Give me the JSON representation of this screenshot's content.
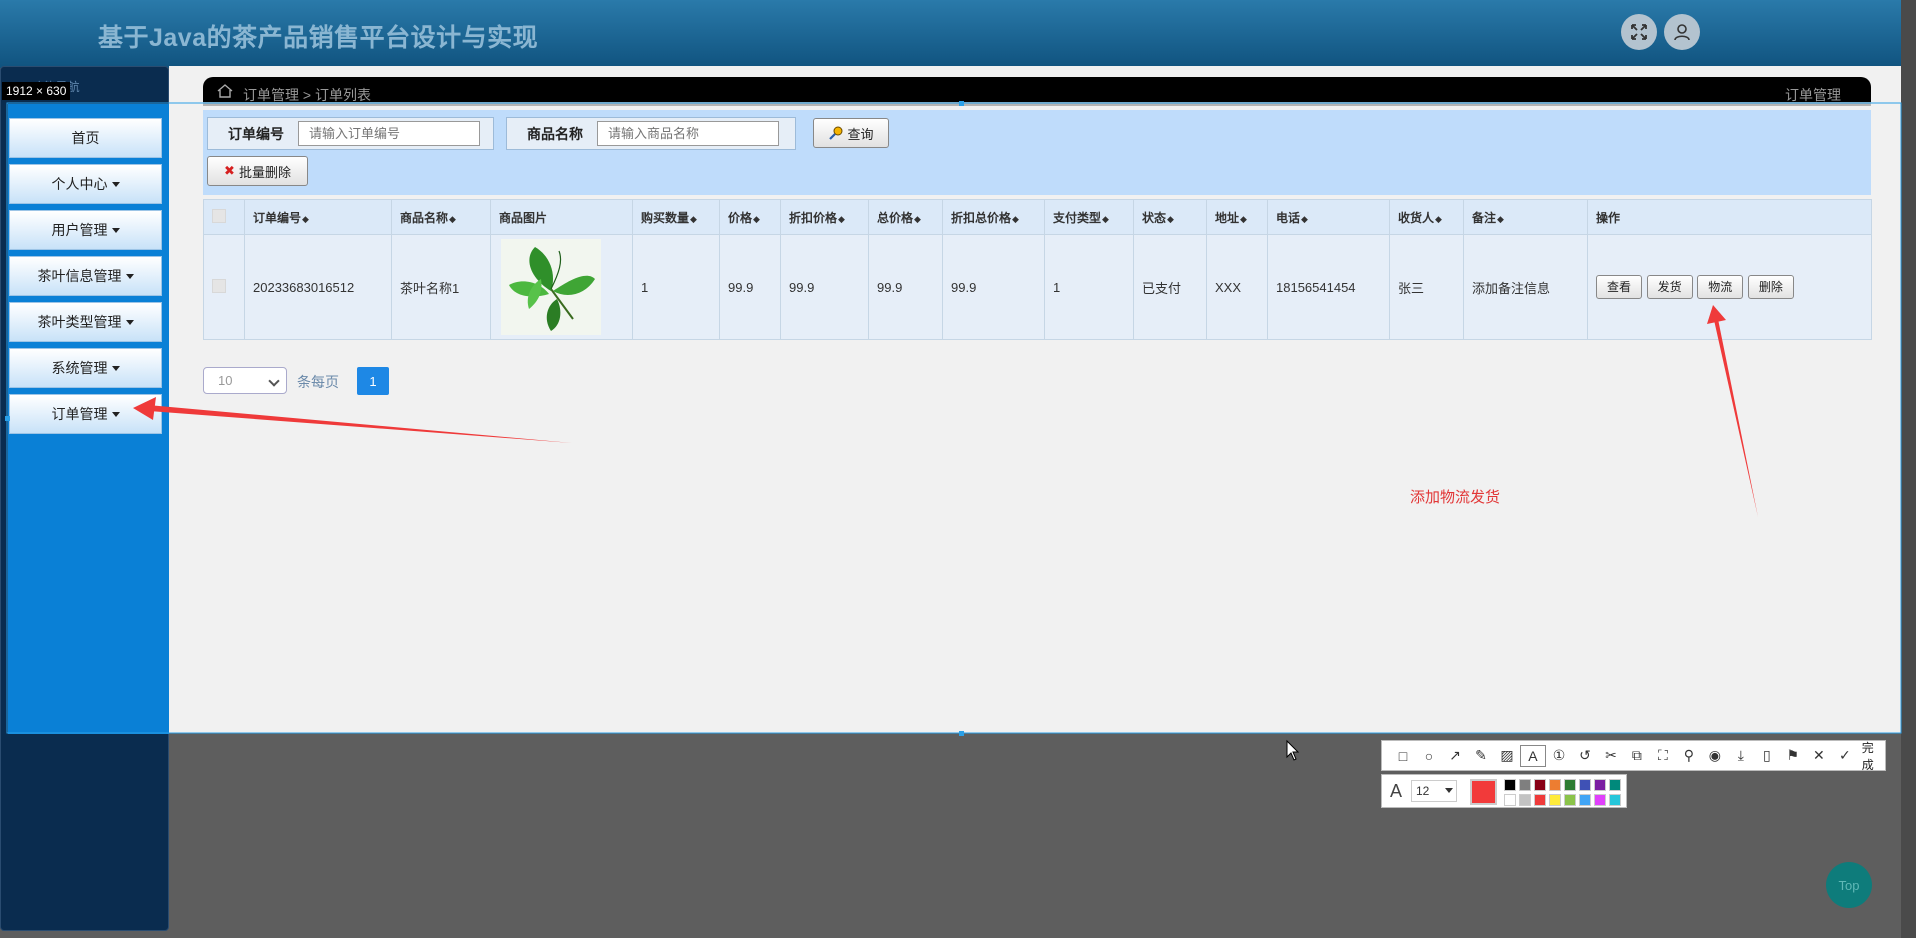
{
  "header": {
    "title": "基于Java的茶产品销售平台设计与实现"
  },
  "sidebar": {
    "heading": "⌂ 功能导航",
    "dimension_label": "1912 × 630",
    "items": [
      {
        "label": "首页",
        "has_caret": false
      },
      {
        "label": "个人中心",
        "has_caret": true
      },
      {
        "label": "用户管理",
        "has_caret": true
      },
      {
        "label": "茶叶信息管理",
        "has_caret": true
      },
      {
        "label": "茶叶类型管理",
        "has_caret": true
      },
      {
        "label": "系统管理",
        "has_caret": true
      },
      {
        "label": "订单管理",
        "has_caret": true
      }
    ]
  },
  "breadcrumb": {
    "path": "订单管理 > 订单列表",
    "right": "订单管理"
  },
  "search": {
    "order_no_label": "订单编号",
    "order_no_placeholder": "请输入订单编号",
    "product_name_label": "商品名称",
    "product_name_placeholder": "请输入商品名称",
    "query_button": "查询",
    "batch_delete_button": "批量删除"
  },
  "table": {
    "headers": [
      "订单编号",
      "商品名称",
      "商品图片",
      "购买数量",
      "价格",
      "折扣价格",
      "总价格",
      "折扣总价格",
      "支付类型",
      "状态",
      "地址",
      "电话",
      "收货人",
      "备注",
      "操作"
    ],
    "rows": [
      {
        "order_no": "20233683016512",
        "product_name": "茶叶名称1",
        "quantity": "1",
        "price": "99.9",
        "discount_price": "99.9",
        "total_price": "99.9",
        "discount_total": "99.9",
        "pay_type": "1",
        "status": "已支付",
        "address": "XXX",
        "phone": "18156541454",
        "receiver": "张三",
        "remark": "添加备注信息"
      }
    ],
    "actions": [
      "查看",
      "发货",
      "物流",
      "删除"
    ]
  },
  "pagination": {
    "page_size": "10",
    "per_page_label": "条每页",
    "current_page": "1"
  },
  "annotation": {
    "text": "添加物流发货",
    "color": "#e23636"
  },
  "screenshot_toolbar": {
    "done_label": "完成",
    "font_size": "12",
    "current_color": "#f23a3a",
    "palette": [
      "#000000",
      "#7f7f7f",
      "#880015",
      "#ed7d31",
      "#2e7d32",
      "#3f51b5",
      "#7b1fa2",
      "#00897b",
      "#ffffff",
      "#c3c3c3",
      "#ef3b3b",
      "#ffeb3b",
      "#8bc34a",
      "#42a5f5",
      "#e040fb",
      "#26c6da"
    ]
  },
  "top_button": {
    "label": "Top"
  },
  "colors": {
    "accent": "#1e88e5",
    "sidebar": "#0a80d6",
    "header": "#10537f"
  }
}
